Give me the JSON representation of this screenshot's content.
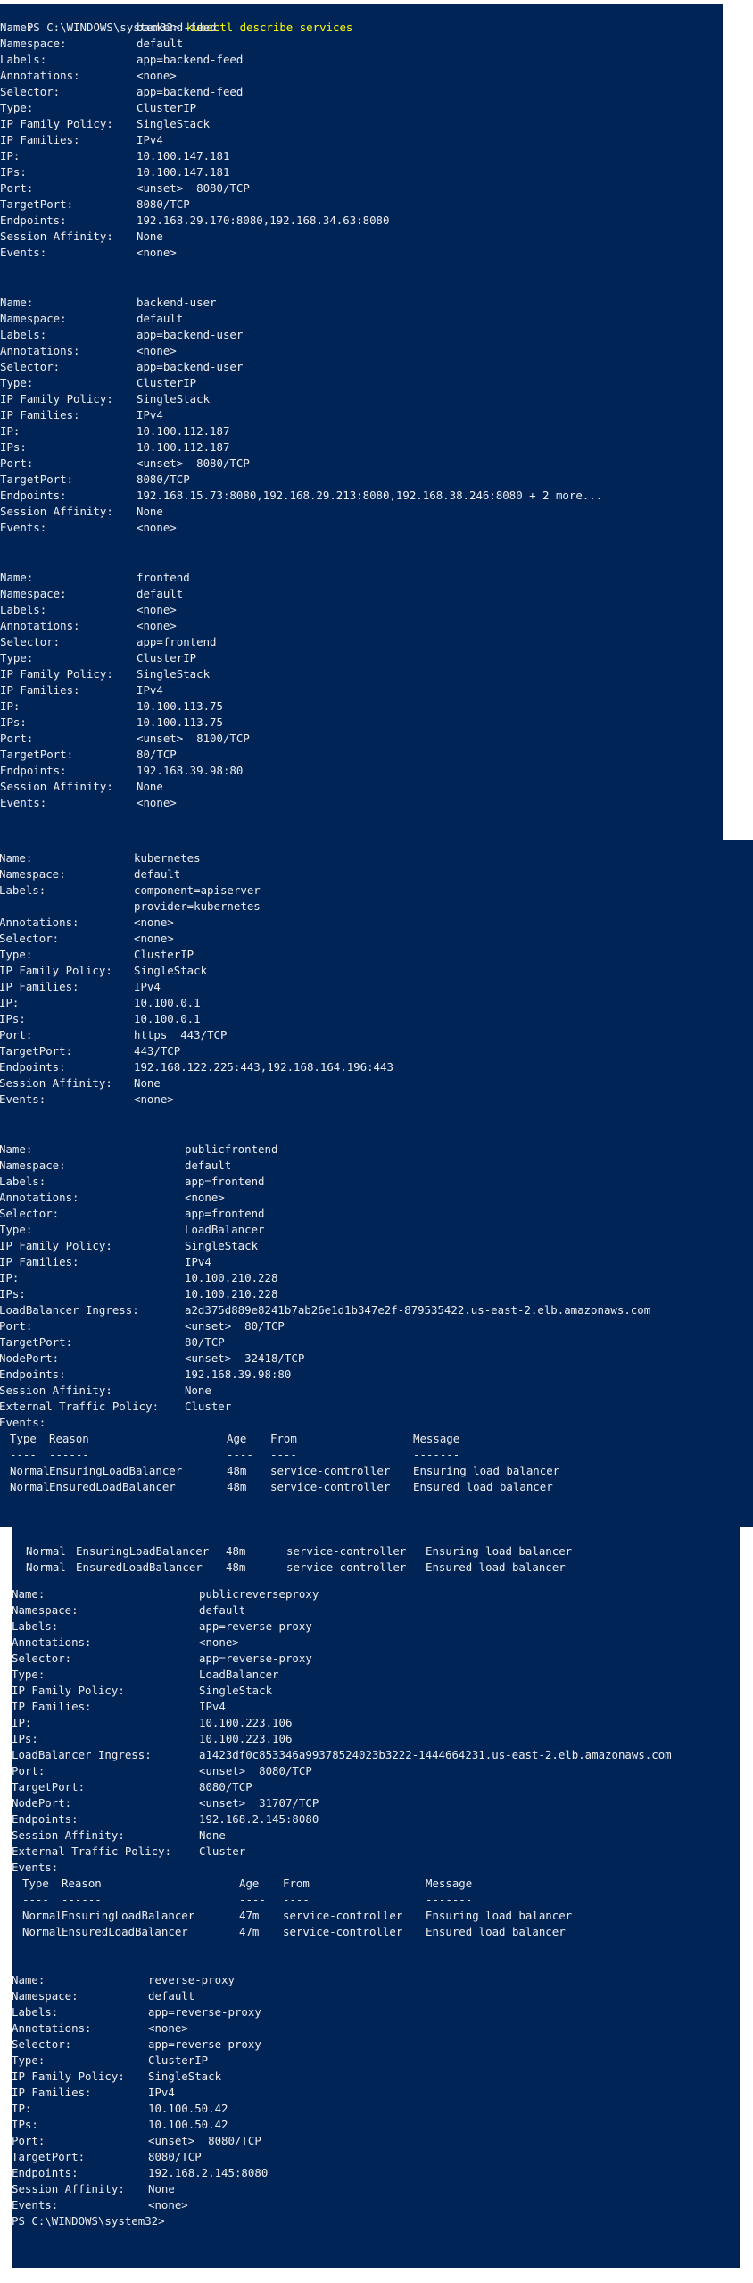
{
  "colors": {
    "background": "#012456",
    "foreground": "#eeedf0",
    "command": "#ffff00"
  },
  "prompt": {
    "path": "PS C:\\WINDOWS\\system32> ",
    "command": "kubectl describe services"
  },
  "prompt_end": "PS C:\\WINDOWS\\system32>",
  "services": [
    {
      "fields": [
        {
          "k": "Name:",
          "v": "backend-feed"
        },
        {
          "k": "Namespace:",
          "v": "default"
        },
        {
          "k": "Labels:",
          "v": "app=backend-feed"
        },
        {
          "k": "Annotations:",
          "v": "<none>"
        },
        {
          "k": "Selector:",
          "v": "app=backend-feed"
        },
        {
          "k": "Type:",
          "v": "ClusterIP"
        },
        {
          "k": "IP Family Policy:",
          "v": "SingleStack"
        },
        {
          "k": "IP Families:",
          "v": "IPv4"
        },
        {
          "k": "IP:",
          "v": "10.100.147.181"
        },
        {
          "k": "IPs:",
          "v": "10.100.147.181"
        },
        {
          "k": "Port:",
          "v": "<unset>  8080/TCP"
        },
        {
          "k": "TargetPort:",
          "v": "8080/TCP"
        },
        {
          "k": "Endpoints:",
          "v": "192.168.29.170:8080,192.168.34.63:8080"
        },
        {
          "k": "Session Affinity:",
          "v": "None"
        },
        {
          "k": "Events:",
          "v": "<none>"
        }
      ]
    },
    {
      "fields": [
        {
          "k": "Name:",
          "v": "backend-user"
        },
        {
          "k": "Namespace:",
          "v": "default"
        },
        {
          "k": "Labels:",
          "v": "app=backend-user"
        },
        {
          "k": "Annotations:",
          "v": "<none>"
        },
        {
          "k": "Selector:",
          "v": "app=backend-user"
        },
        {
          "k": "Type:",
          "v": "ClusterIP"
        },
        {
          "k": "IP Family Policy:",
          "v": "SingleStack"
        },
        {
          "k": "IP Families:",
          "v": "IPv4"
        },
        {
          "k": "IP:",
          "v": "10.100.112.187"
        },
        {
          "k": "IPs:",
          "v": "10.100.112.187"
        },
        {
          "k": "Port:",
          "v": "<unset>  8080/TCP"
        },
        {
          "k": "TargetPort:",
          "v": "8080/TCP"
        },
        {
          "k": "Endpoints:",
          "v": "192.168.15.73:8080,192.168.29.213:8080,192.168.38.246:8080 + 2 more..."
        },
        {
          "k": "Session Affinity:",
          "v": "None"
        },
        {
          "k": "Events:",
          "v": "<none>"
        }
      ]
    },
    {
      "fields": [
        {
          "k": "Name:",
          "v": "frontend"
        },
        {
          "k": "Namespace:",
          "v": "default"
        },
        {
          "k": "Labels:",
          "v": "<none>"
        },
        {
          "k": "Annotations:",
          "v": "<none>"
        },
        {
          "k": "Selector:",
          "v": "app=frontend"
        },
        {
          "k": "Type:",
          "v": "ClusterIP"
        },
        {
          "k": "IP Family Policy:",
          "v": "SingleStack"
        },
        {
          "k": "IP Families:",
          "v": "IPv4"
        },
        {
          "k": "IP:",
          "v": "10.100.113.75"
        },
        {
          "k": "IPs:",
          "v": "10.100.113.75"
        },
        {
          "k": "Port:",
          "v": "<unset>  8100/TCP"
        },
        {
          "k": "TargetPort:",
          "v": "80/TCP"
        },
        {
          "k": "Endpoints:",
          "v": "192.168.39.98:80"
        },
        {
          "k": "Session Affinity:",
          "v": "None"
        },
        {
          "k": "Events:",
          "v": "<none>"
        }
      ]
    },
    {
      "fields": [
        {
          "k": "Name:",
          "v": "kubernetes"
        },
        {
          "k": "Namespace:",
          "v": "default"
        },
        {
          "k": "Labels:",
          "v": "component=apiserver"
        },
        {
          "k": "",
          "v": "provider=kubernetes"
        },
        {
          "k": "Annotations:",
          "v": "<none>"
        },
        {
          "k": "Selector:",
          "v": "<none>"
        },
        {
          "k": "Type:",
          "v": "ClusterIP"
        },
        {
          "k": "IP Family Policy:",
          "v": "SingleStack"
        },
        {
          "k": "IP Families:",
          "v": "IPv4"
        },
        {
          "k": "IP:",
          "v": "10.100.0.1"
        },
        {
          "k": "IPs:",
          "v": "10.100.0.1"
        },
        {
          "k": "Port:",
          "v": "https  443/TCP"
        },
        {
          "k": "TargetPort:",
          "v": "443/TCP"
        },
        {
          "k": "Endpoints:",
          "v": "192.168.122.225:443,192.168.164.196:443"
        },
        {
          "k": "Session Affinity:",
          "v": "None"
        },
        {
          "k": "Events:",
          "v": "<none>"
        }
      ]
    },
    {
      "fields": [
        {
          "k": "Name:",
          "v": "publicfrontend"
        },
        {
          "k": "Namespace:",
          "v": "default"
        },
        {
          "k": "Labels:",
          "v": "app=frontend"
        },
        {
          "k": "Annotations:",
          "v": "<none>"
        },
        {
          "k": "Selector:",
          "v": "app=frontend"
        },
        {
          "k": "Type:",
          "v": "LoadBalancer"
        },
        {
          "k": "IP Family Policy:",
          "v": "SingleStack"
        },
        {
          "k": "IP Families:",
          "v": "IPv4"
        },
        {
          "k": "IP:",
          "v": "10.100.210.228"
        },
        {
          "k": "IPs:",
          "v": "10.100.210.228"
        },
        {
          "k": "LoadBalancer Ingress:",
          "v": "a2d375d889e8241b7ab26e1d1b347e2f-879535422.us-east-2.elb.amazonaws.com"
        },
        {
          "k": "Port:",
          "v": "<unset>  80/TCP"
        },
        {
          "k": "TargetPort:",
          "v": "80/TCP"
        },
        {
          "k": "NodePort:",
          "v": "<unset>  32418/TCP"
        },
        {
          "k": "Endpoints:",
          "v": "192.168.39.98:80"
        },
        {
          "k": "Session Affinity:",
          "v": "None"
        },
        {
          "k": "External Traffic Policy:",
          "v": "Cluster"
        },
        {
          "k": "Events:",
          "v": ""
        }
      ],
      "events": {
        "header": {
          "type": "Type",
          "reason": "Reason",
          "age": "Age",
          "from": "From",
          "message": "Message"
        },
        "rule": {
          "type": "----",
          "reason": "------",
          "age": "----",
          "from": "----",
          "message": "-------"
        },
        "rows": [
          {
            "type": "Normal",
            "reason": "EnsuringLoadBalancer",
            "age": "48m",
            "from": "service-controller",
            "message": "Ensuring load balancer"
          },
          {
            "type": "Normal",
            "reason": "EnsuredLoadBalancer",
            "age": "48m",
            "from": "service-controller",
            "message": "Ensured load balancer"
          }
        ]
      }
    },
    {
      "fields": [
        {
          "k": "Name:",
          "v": "publicreverseproxy"
        },
        {
          "k": "Namespace:",
          "v": "default"
        },
        {
          "k": "Labels:",
          "v": "app=reverse-proxy"
        },
        {
          "k": "Annotations:",
          "v": "<none>"
        },
        {
          "k": "Selector:",
          "v": "app=reverse-proxy"
        },
        {
          "k": "Type:",
          "v": "LoadBalancer"
        },
        {
          "k": "IP Family Policy:",
          "v": "SingleStack"
        },
        {
          "k": "IP Families:",
          "v": "IPv4"
        },
        {
          "k": "IP:",
          "v": "10.100.223.106"
        },
        {
          "k": "IPs:",
          "v": "10.100.223.106"
        },
        {
          "k": "LoadBalancer Ingress:",
          "v": "a1423df0c853346a99378524023b3222-1444664231.us-east-2.elb.amazonaws.com"
        },
        {
          "k": "Port:",
          "v": "<unset>  8080/TCP"
        },
        {
          "k": "TargetPort:",
          "v": "8080/TCP"
        },
        {
          "k": "NodePort:",
          "v": "<unset>  31707/TCP"
        },
        {
          "k": "Endpoints:",
          "v": "192.168.2.145:8080"
        },
        {
          "k": "Session Affinity:",
          "v": "None"
        },
        {
          "k": "External Traffic Policy:",
          "v": "Cluster"
        },
        {
          "k": "Events:",
          "v": ""
        }
      ],
      "events": {
        "header": {
          "type": "Type",
          "reason": "Reason",
          "age": "Age",
          "from": "From",
          "message": "Message"
        },
        "rule": {
          "type": "----",
          "reason": "------",
          "age": "----",
          "from": "----",
          "message": "-------"
        },
        "rows": [
          {
            "type": "Normal",
            "reason": "EnsuringLoadBalancer",
            "age": "47m",
            "from": "service-controller",
            "message": "Ensuring load balancer"
          },
          {
            "type": "Normal",
            "reason": "EnsuredLoadBalancer",
            "age": "47m",
            "from": "service-controller",
            "message": "Ensured load balancer"
          }
        ]
      }
    },
    {
      "fields": [
        {
          "k": "Name:",
          "v": "reverse-proxy"
        },
        {
          "k": "Namespace:",
          "v": "default"
        },
        {
          "k": "Labels:",
          "v": "app=reverse-proxy"
        },
        {
          "k": "Annotations:",
          "v": "<none>"
        },
        {
          "k": "Selector:",
          "v": "app=reverse-proxy"
        },
        {
          "k": "Type:",
          "v": "ClusterIP"
        },
        {
          "k": "IP Family Policy:",
          "v": "SingleStack"
        },
        {
          "k": "IP Families:",
          "v": "IPv4"
        },
        {
          "k": "IP:",
          "v": "10.100.50.42"
        },
        {
          "k": "IPs:",
          "v": "10.100.50.42"
        },
        {
          "k": "Port:",
          "v": "<unset>  8080/TCP"
        },
        {
          "k": "TargetPort:",
          "v": "8080/TCP"
        },
        {
          "k": "Endpoints:",
          "v": "192.168.2.145:8080"
        },
        {
          "k": "Session Affinity:",
          "v": "None"
        },
        {
          "k": "Events:",
          "v": "<none>"
        }
      ]
    }
  ],
  "overlap_events": {
    "rows": [
      {
        "type": "Normal",
        "reason": "EnsuringLoadBalancer",
        "age": "48m",
        "from": "service-controller",
        "message": "Ensuring load balancer"
      },
      {
        "type": "Normal",
        "reason": "EnsuredLoadBalancer",
        "age": "48m",
        "from": "service-controller",
        "message": "Ensured load balancer"
      }
    ]
  }
}
